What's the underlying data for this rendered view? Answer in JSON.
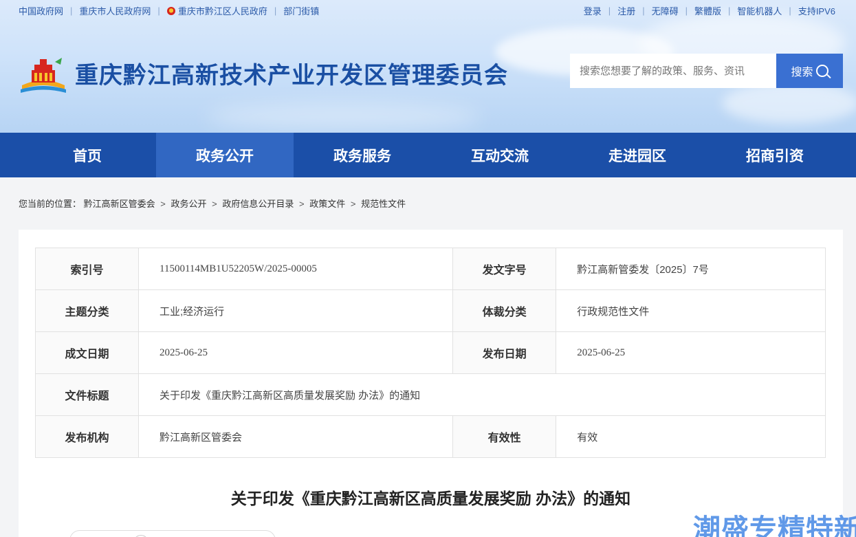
{
  "topbar": {
    "left_links": [
      "中国政府网",
      "重庆市人民政府网",
      "重庆市黔江区人民政府",
      "部门街镇"
    ],
    "right_links": [
      "登录",
      "注册",
      "无障碍",
      "繁體版",
      "智能机器人",
      "支持IPV6"
    ]
  },
  "header": {
    "site_title": "重庆黔江高新技术产业开发区管理委员会",
    "search_placeholder": "搜索您想要了解的政策、服务、资讯",
    "search_button": "搜索"
  },
  "nav": {
    "items": [
      "首页",
      "政务公开",
      "政务服务",
      "互动交流",
      "走进园区",
      "招商引资"
    ],
    "active_index": 1
  },
  "breadcrumb": {
    "prefix": "您当前的位置：",
    "items": [
      "黔江高新区管委会",
      "政务公开",
      "政府信息公开目录",
      "政策文件",
      "规范性文件"
    ]
  },
  "meta": {
    "index_no_label": "索引号",
    "index_no": "11500114MB1U52205W/2025-00005",
    "doc_no_label": "发文字号",
    "doc_no": "黔江高新管委发〔2025〕7号",
    "topic_label": "主题分类",
    "topic": "工业;经济运行",
    "genre_label": "体裁分类",
    "genre": "行政规范性文件",
    "written_date_label": "成文日期",
    "written_date": "2025-06-25",
    "publish_date_label": "发布日期",
    "publish_date": "2025-06-25",
    "doc_title_label": "文件标题",
    "doc_title": "关于印发《重庆黔江高新区高质量发展奖励 办法》的通知",
    "publisher_label": "发布机构",
    "publisher": "黔江高新区管委会",
    "validity_label": "有效性",
    "validity": "有效"
  },
  "article": {
    "title": "关于印发《重庆黔江高新区高质量发展奖励 办法》的通知"
  },
  "watermark": "潮盛专精特新"
}
